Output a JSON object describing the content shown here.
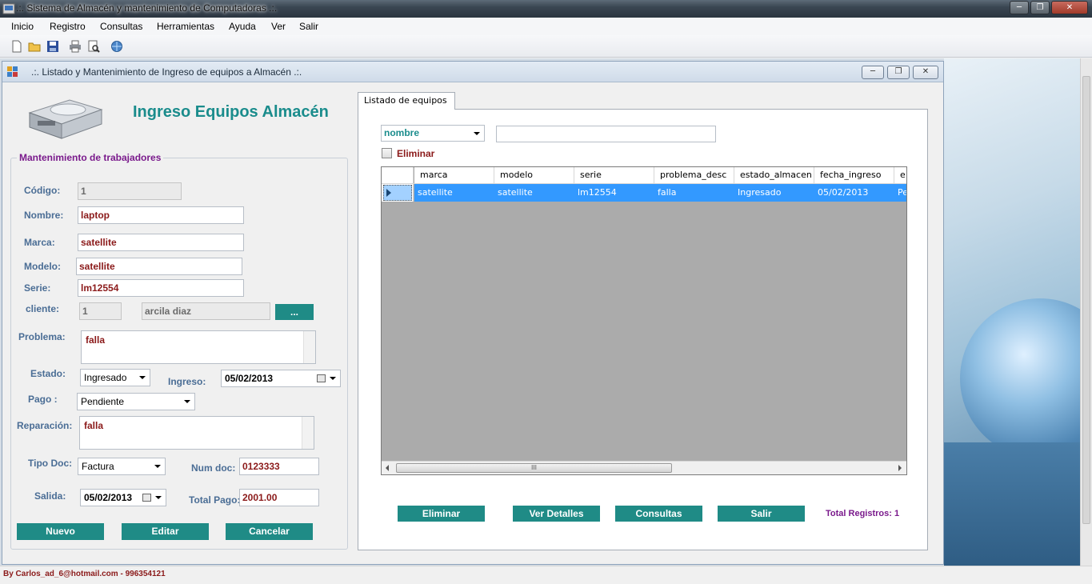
{
  "window": {
    "title": ".:. Sistema de Almacén y mantenimiento de Computadoras .:.",
    "min_icon": "minimize-icon",
    "max_icon": "maximize-icon",
    "close_icon": "close-icon"
  },
  "menu": {
    "items": [
      "Inicio",
      "Registro",
      "Consultas",
      "Herramientas",
      "Ayuda",
      "Ver",
      "Salir"
    ]
  },
  "toolbar": {
    "icons": [
      "new-file-icon",
      "open-folder-icon",
      "save-icon",
      "print-icon",
      "print-preview-icon",
      "help-globe-icon"
    ]
  },
  "child": {
    "title": ".:. Listado y Mantenimiento de Ingreso de equipos a Almacén .:.",
    "heading": "Ingreso Equipos Almacén",
    "group_title": "Mantenimiento de trabajadores",
    "labels": {
      "codigo": "Código:",
      "nombre": "Nombre:",
      "marca": "Marca:",
      "modelo": "Modelo:",
      "serie": "Serie:",
      "cliente": "cliente:",
      "problema": "Problema:",
      "estado": "Estado:",
      "ingreso": "Ingreso:",
      "pago": "Pago :",
      "reparacion": "Reparación:",
      "tipo_doc": "Tipo Doc:",
      "num_doc": "Num doc:",
      "salida": "Salida:",
      "total_pago": "Total Pago:"
    },
    "values": {
      "codigo": "1",
      "nombre": "laptop",
      "marca": "satellite",
      "modelo": "satellite",
      "serie": "lm12554",
      "cliente_id": "1",
      "cliente_nombre": "arcila diaz",
      "cliente_button": "...",
      "problema": "falla",
      "estado": "Ingresado",
      "ingreso": "05/02/2013",
      "pago": "Pendiente",
      "reparacion": "falla",
      "tipo_doc": "Factura",
      "num_doc": "0123333",
      "salida": "05/02/2013",
      "total_pago": "2001.00"
    },
    "buttons": {
      "nuevo": "Nuevo",
      "editar": "Editar",
      "cancelar": "Cancelar"
    }
  },
  "listado": {
    "tab_label": "Listado de equipos",
    "search_field": "nombre",
    "search_value": "",
    "eliminar_check_label": "Eliminar",
    "columns": [
      "marca",
      "modelo",
      "serie",
      "problema_desc",
      "estado_almacen",
      "fecha_ingreso",
      "e"
    ],
    "rows": [
      [
        "satellite",
        "satellite",
        "lm12554",
        "falla",
        "Ingresado",
        "05/02/2013",
        "Pe"
      ]
    ],
    "scroll_thumb": "III",
    "buttons": {
      "eliminar": "Eliminar",
      "ver_detalles": "Ver Detalles",
      "consultas": "Consultas",
      "salir": "Salir"
    },
    "total_registros": "Total Registros: 1"
  },
  "status": {
    "credit": "By Carlos_ad_6@hotmail.com - 996354121"
  },
  "colors": {
    "accent_teal": "#1f8b86",
    "heading_teal": "#1a8c8c",
    "label_blue": "#4a6d95",
    "value_red": "#8b1a1a",
    "group_purple": "#7a1a8c",
    "selection_blue": "#3399ff"
  }
}
